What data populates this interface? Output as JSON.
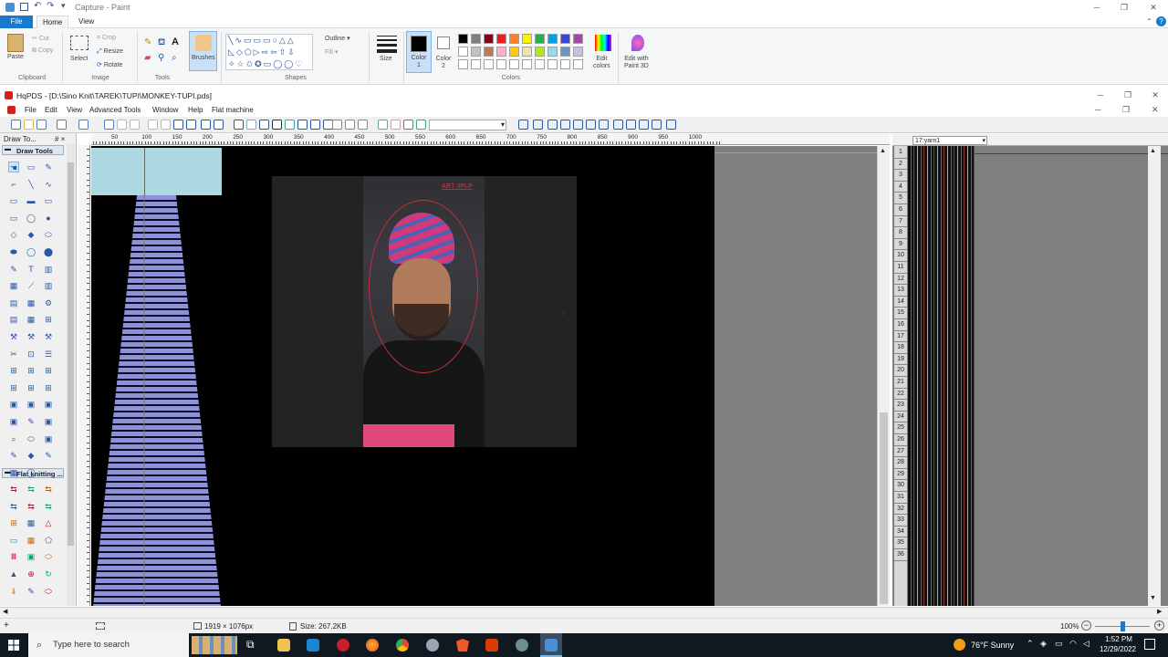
{
  "paint": {
    "title": "Capture - Paint",
    "tabs": [
      "File",
      "Home",
      "View"
    ],
    "clipboard": {
      "paste": "Paste",
      "cut": "Cut",
      "copy": "Copy",
      "label": "Clipboard"
    },
    "image": {
      "select": "Select",
      "crop": "Crop",
      "resize": "Resize",
      "rotate": "Rotate",
      "label": "Image"
    },
    "tools_label": "Tools",
    "brushes": "Brushes",
    "shapes": {
      "outline": "Outline",
      "fill": "Fill",
      "label": "Shapes"
    },
    "size": "Size",
    "color1": "Color\n1",
    "color1_a": "Color",
    "color1_b": "1",
    "color2_a": "Color",
    "color2_b": "2",
    "colors_label": "Colors",
    "edit_colors_a": "Edit",
    "edit_colors_b": "colors",
    "edit3d_a": "Edit with",
    "edit3d_b": "Paint 3D",
    "palette_row1": [
      "#000000",
      "#7f7f7f",
      "#880015",
      "#ed1c24",
      "#ff7f27",
      "#fff200",
      "#22b14c",
      "#00a2e8",
      "#3f48cc",
      "#a349a4"
    ],
    "palette_row2": [
      "#ffffff",
      "#c3c3c3",
      "#b97a57",
      "#ffaec9",
      "#ffc90e",
      "#efe4b0",
      "#b5e61d",
      "#99d9ea",
      "#7092be",
      "#c8bfe7"
    ],
    "status_size": "1919 × 1076px",
    "status_filesize": "Size: 267.2KB",
    "zoom": "100%"
  },
  "hq": {
    "title": "HqPDS - [D:\\Sino Knit\\TAREK\\TUPI\\MONKEY-TUPI.pds]",
    "menu": [
      "File",
      "Edit",
      "View",
      "Advanced Tools",
      "Window",
      "Help",
      "Flat machine"
    ],
    "panel_title": "Draw To...",
    "panel_pin": "# ×",
    "draw_tools": "Draw Tools",
    "flat_knitting": "Flat knitting ...",
    "yarn_select": "17:yarn1",
    "ruler_ticks": [
      "50",
      "100",
      "150",
      "200",
      "250",
      "300",
      "350",
      "400",
      "450",
      "500",
      "550",
      "600",
      "650",
      "700",
      "750",
      "800",
      "850",
      "900",
      "950",
      "1000"
    ],
    "row_numbers": [
      "1",
      "2",
      "3",
      "4",
      "5",
      "6",
      "7",
      "8",
      "9",
      "10",
      "11",
      "12",
      "13",
      "14",
      "15",
      "16",
      "17",
      "18",
      "19",
      "20",
      "21",
      "22",
      "23",
      "24",
      "25",
      "26",
      "27",
      "28",
      "29",
      "30",
      "31",
      "32",
      "33",
      "34",
      "35",
      "36"
    ],
    "photo_caption": "ART JPLP"
  },
  "taskbar": {
    "search_placeholder": "Type here to search",
    "weather": "76°F  Sunny",
    "time": "1:52 PM",
    "date": "12/29/2022"
  }
}
